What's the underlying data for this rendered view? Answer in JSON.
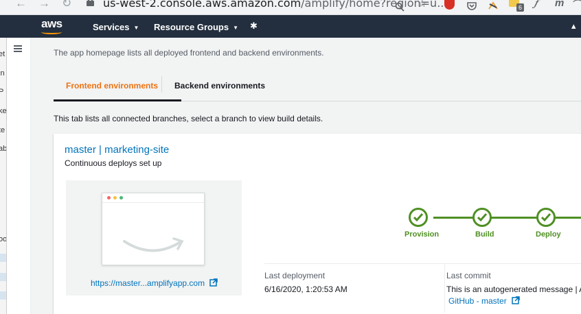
{
  "browser": {
    "back_icon": "arrow-left",
    "back_glyph": "←",
    "forward_icon": "arrow-right",
    "forward_glyph": "→",
    "reload_icon": "reload",
    "reload_glyph": "↻",
    "url_host": "us-west-2.console.aws.amazon.com",
    "url_path": "/amplify/home?region=u...",
    "star_glyph": "☆",
    "extension_badge": "6",
    "ext_music": "𝆑",
    "ext_m": "m",
    "ext_wave": "⌒"
  },
  "aws_nav": {
    "logo": "aws",
    "services_label": "Services",
    "resource_groups_label": "Resource Groups",
    "caret_glyph": "▼",
    "pin_glyph": "✱",
    "bell_glyph": "▴"
  },
  "left_strip": {
    "letters": [
      "et",
      "in",
      "P",
      "ke",
      "te",
      "ab",
      "oo"
    ]
  },
  "intro_text": "The app homepage lists all deployed frontend and backend environments.",
  "tabs": [
    {
      "label": "Frontend environments",
      "active": true
    },
    {
      "label": "Backend environments",
      "active": false
    }
  ],
  "tab_description": "This tab lists all connected branches, select a branch to view build details.",
  "branch": {
    "title": "master | marketing-site",
    "subtitle": "Continuous deploys set up",
    "preview_url": "https://master...amplifyapp.com"
  },
  "pipeline": {
    "steps": [
      "Provision",
      "Build",
      "Deploy"
    ],
    "color": "#4f8f23"
  },
  "deployment": {
    "last_deployment_label": "Last deployment",
    "last_deployment_value": "6/16/2020, 1:20:53 AM",
    "last_commit_label": "Last commit",
    "last_commit_value": "This is an autogenerated message | Aut",
    "commit_link": "GitHub - master"
  },
  "colors": {
    "aws_nav_bg": "#232f3e",
    "active_tab": "#ec7211",
    "link": "#0073bb"
  }
}
